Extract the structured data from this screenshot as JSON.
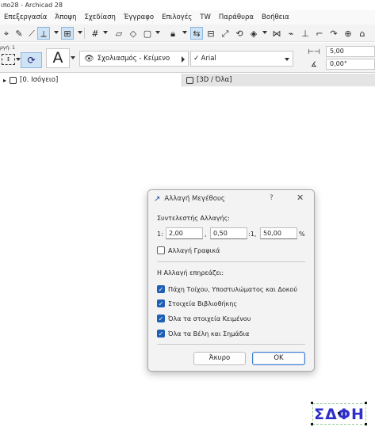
{
  "window": {
    "title": "ιπο28 - Archicad 28"
  },
  "menu": [
    "Επεξεργασία",
    "Άποψη",
    "Σχεδίαση",
    "Έγγραφο",
    "Επιλογές",
    "TW",
    "Παράθυρα",
    "Βοήθεια"
  ],
  "infobox": {
    "geometry_label": "ργή: 1",
    "text_style_letter": "A",
    "layer": "Σχολιασμός - Κείμενο",
    "font": "Arial",
    "text_size": "5,00",
    "angle": "0,00°"
  },
  "tabs": [
    {
      "label": "[0. Ισόγειο]",
      "active": true
    },
    {
      "label": "[3D / Όλα]",
      "active": false
    }
  ],
  "dialog": {
    "title": "Αλλαγή Μεγέθους",
    "help_symbol": "?",
    "close_symbol": "✕",
    "factor_label": "Συντελεστής Αλλαγής:",
    "ratio_prefix": "1:",
    "value1": "2,00",
    "sep1": ",",
    "value2": "0,50",
    "sep2": ":1,",
    "value3": "50,00",
    "percent": "%",
    "graphics_label": "Αλλαγή Γραφικά",
    "graphics_checked": false,
    "affects_label": "Η Αλλαγή επηρεάζει:",
    "options": [
      {
        "label": "Πάχη Τοίχου, Υποστυλώματος και Δοκού",
        "checked": true
      },
      {
        "label": "Στοιχεία Βιβλιοθήκης",
        "checked": true
      },
      {
        "label": "Όλα τα στοιχεία Κειμένου",
        "checked": true
      },
      {
        "label": "Όλα τα Βέλη και Σημάδια",
        "checked": true
      }
    ],
    "cancel_label": "Άκυρο",
    "ok_label": "OK"
  },
  "canvas_logo": {
    "text": "ΣΔΦΗ",
    "color": "#2e2ec8"
  },
  "colors": {
    "accent": "#1f5fb4",
    "selected_tool": "#cfe3f7"
  }
}
